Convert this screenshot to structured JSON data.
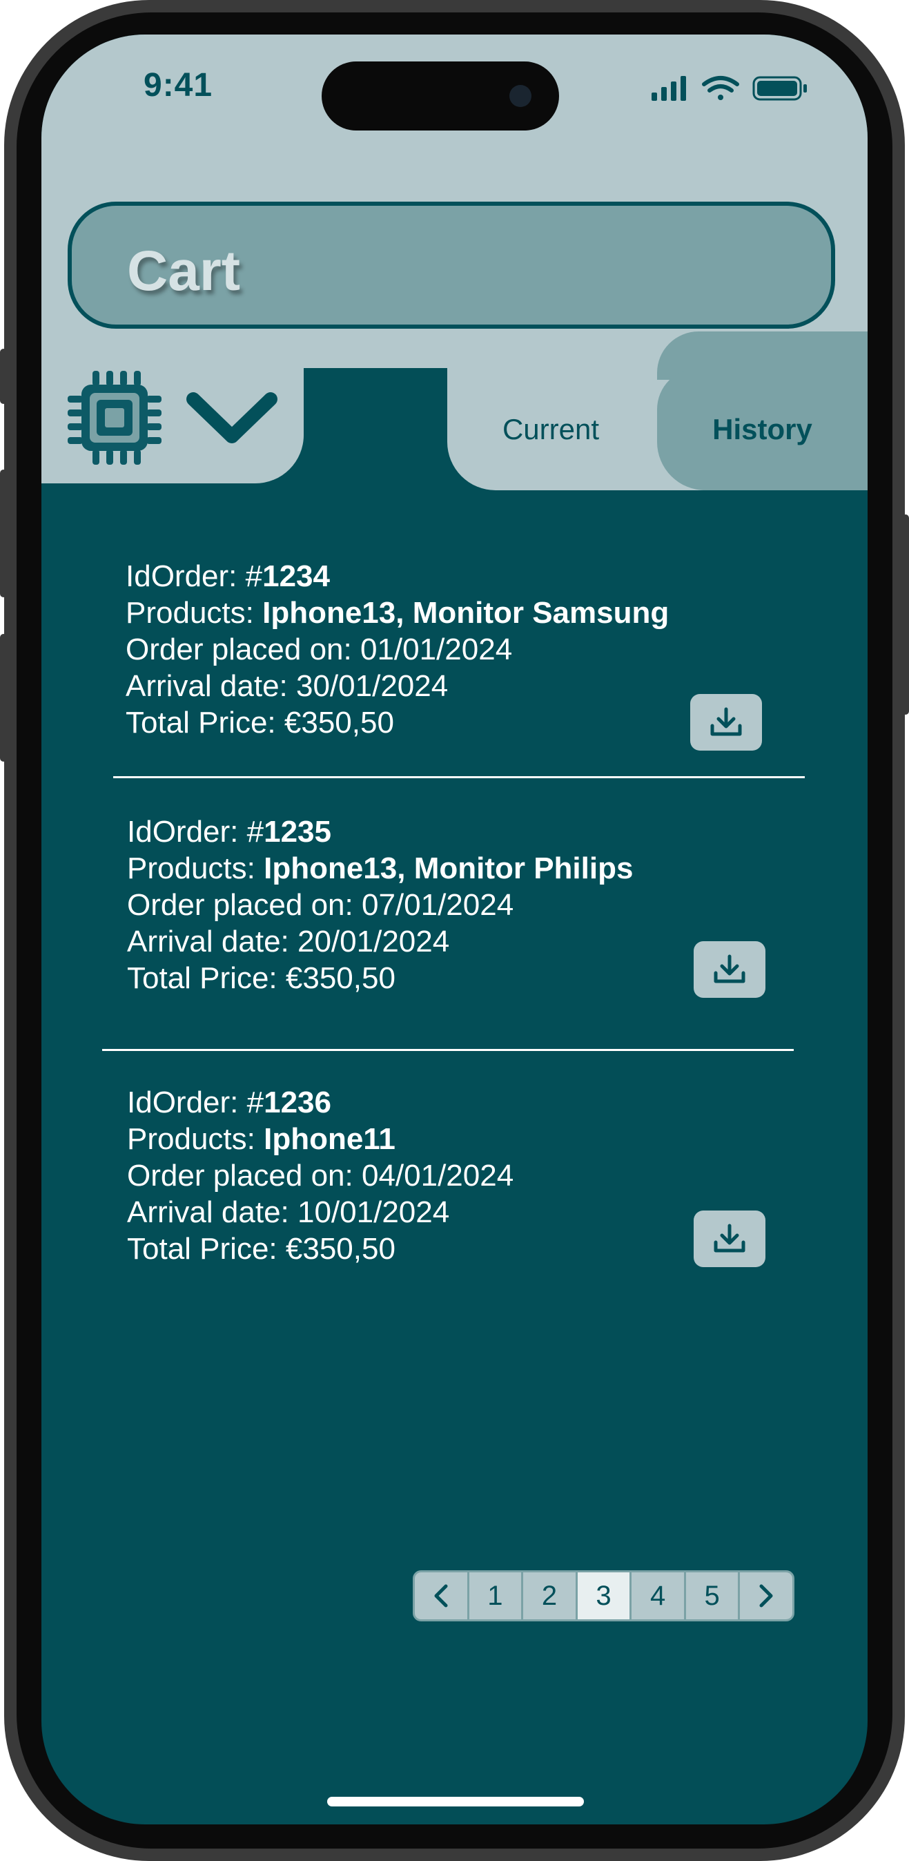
{
  "status_bar": {
    "time": "9:41"
  },
  "header": {
    "search_text": "Cart"
  },
  "tabs": [
    {
      "label": "Current",
      "active": false
    },
    {
      "label": "History",
      "active": true
    }
  ],
  "orders": [
    {
      "id_label": "IdOrder: #",
      "id": "1234",
      "products_label": "Products: ",
      "products": "Iphone13,  Monitor Samsung",
      "placed_label": "Order placed on: ",
      "placed": "01/01/2024",
      "arrival_label": "Arrival date: ",
      "arrival": "30/01/2024",
      "price_label": "Total Price: ",
      "price": "€350,50"
    },
    {
      "id_label": "IdOrder: #",
      "id": "1235",
      "products_label": "Products: ",
      "products": "Iphone13,  Monitor Philips",
      "placed_label": "Order placed on: ",
      "placed": "07/01/2024",
      "arrival_label": "Arrival date: ",
      "arrival": "20/01/2024",
      "price_label": "Total Price: ",
      "price": "€350,50"
    },
    {
      "id_label": "IdOrder: #",
      "id": "1236",
      "products_label": "Products: ",
      "products": "Iphone11",
      "placed_label": "Order placed on: ",
      "placed": "04/01/2024",
      "arrival_label": "Arrival date: ",
      "arrival": "10/01/2024",
      "price_label": "Total Price: ",
      "price": "€350,50"
    }
  ],
  "pagination": {
    "pages": [
      "1",
      "2",
      "3",
      "4",
      "5"
    ],
    "current": "3",
    "prev": "‹",
    "next": "›"
  },
  "colors": {
    "background": "#034e57",
    "panel": "#b4c8cc",
    "accent": "#7ba2a6",
    "text_dark": "#03505a",
    "text_light": "#ffffff"
  }
}
